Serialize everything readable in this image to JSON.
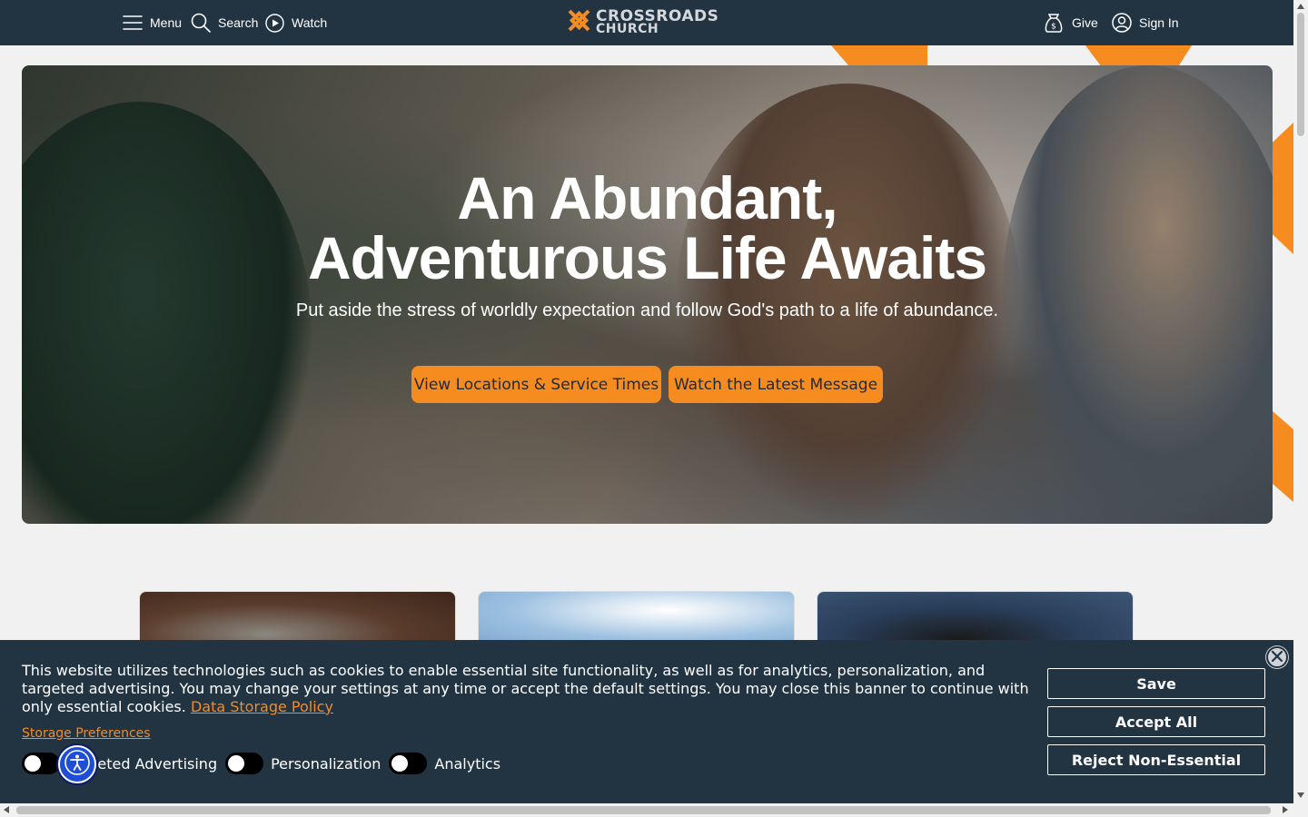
{
  "header": {
    "menu_label": "Menu",
    "search_label": "Search",
    "watch_label": "Watch",
    "brand_line1": "CROSSROADS",
    "brand_line2": "CHURCH",
    "give_label": "Give",
    "signin_label": "Sign In"
  },
  "hero": {
    "title_line1": "An Abundant,",
    "title_line2": "Adventurous Life Awaits",
    "subtitle": "Put aside the stress of worldly expectation and follow God's path to a life of abundance.",
    "primary_button": "View Locations & Service Times",
    "secondary_button": "Watch the Latest Message"
  },
  "cookie_banner": {
    "text": "This website utilizes technologies such as cookies to enable essential site functionality, as well as for analytics, personalization, and targeted advertising. You may change your settings at any time or accept the default settings. You may close this banner to continue with only essential cookies.",
    "policy_link": "Data Storage Policy",
    "preferences_link": "Storage Preferences",
    "toggles": [
      "Targeted Advertising",
      "Personalization",
      "Analytics"
    ],
    "save_button": "Save",
    "accept_button": "Accept All",
    "reject_button": "Reject Non-Essential"
  },
  "colors": {
    "brand_orange": "#f68b1f",
    "navy": "#223342"
  },
  "icons": [
    "menu-icon",
    "search-icon",
    "play-icon",
    "crossroads-logo-icon",
    "give-icon",
    "user-icon",
    "close-icon",
    "accessibility-icon"
  ]
}
